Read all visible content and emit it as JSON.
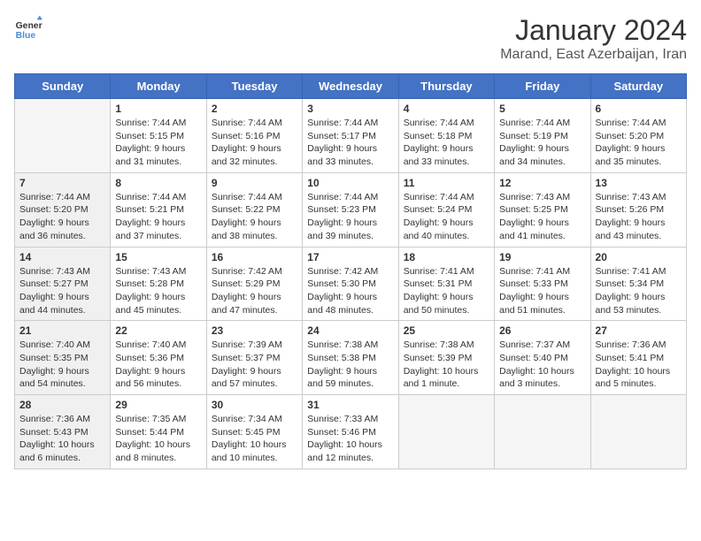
{
  "header": {
    "logo_line1": "General",
    "logo_line2": "Blue",
    "month_title": "January 2024",
    "subtitle": "Marand, East Azerbaijan, Iran"
  },
  "weekdays": [
    "Sunday",
    "Monday",
    "Tuesday",
    "Wednesday",
    "Thursday",
    "Friday",
    "Saturday"
  ],
  "weeks": [
    [
      {
        "day": "",
        "info": "",
        "shaded": true
      },
      {
        "day": "1",
        "info": "Sunrise: 7:44 AM\nSunset: 5:15 PM\nDaylight: 9 hours\nand 31 minutes.",
        "shaded": false
      },
      {
        "day": "2",
        "info": "Sunrise: 7:44 AM\nSunset: 5:16 PM\nDaylight: 9 hours\nand 32 minutes.",
        "shaded": false
      },
      {
        "day": "3",
        "info": "Sunrise: 7:44 AM\nSunset: 5:17 PM\nDaylight: 9 hours\nand 33 minutes.",
        "shaded": false
      },
      {
        "day": "4",
        "info": "Sunrise: 7:44 AM\nSunset: 5:18 PM\nDaylight: 9 hours\nand 33 minutes.",
        "shaded": false
      },
      {
        "day": "5",
        "info": "Sunrise: 7:44 AM\nSunset: 5:19 PM\nDaylight: 9 hours\nand 34 minutes.",
        "shaded": false
      },
      {
        "day": "6",
        "info": "Sunrise: 7:44 AM\nSunset: 5:20 PM\nDaylight: 9 hours\nand 35 minutes.",
        "shaded": false
      }
    ],
    [
      {
        "day": "7",
        "info": "Sunrise: 7:44 AM\nSunset: 5:20 PM\nDaylight: 9 hours\nand 36 minutes.",
        "shaded": true
      },
      {
        "day": "8",
        "info": "Sunrise: 7:44 AM\nSunset: 5:21 PM\nDaylight: 9 hours\nand 37 minutes.",
        "shaded": false
      },
      {
        "day": "9",
        "info": "Sunrise: 7:44 AM\nSunset: 5:22 PM\nDaylight: 9 hours\nand 38 minutes.",
        "shaded": false
      },
      {
        "day": "10",
        "info": "Sunrise: 7:44 AM\nSunset: 5:23 PM\nDaylight: 9 hours\nand 39 minutes.",
        "shaded": false
      },
      {
        "day": "11",
        "info": "Sunrise: 7:44 AM\nSunset: 5:24 PM\nDaylight: 9 hours\nand 40 minutes.",
        "shaded": false
      },
      {
        "day": "12",
        "info": "Sunrise: 7:43 AM\nSunset: 5:25 PM\nDaylight: 9 hours\nand 41 minutes.",
        "shaded": false
      },
      {
        "day": "13",
        "info": "Sunrise: 7:43 AM\nSunset: 5:26 PM\nDaylight: 9 hours\nand 43 minutes.",
        "shaded": false
      }
    ],
    [
      {
        "day": "14",
        "info": "Sunrise: 7:43 AM\nSunset: 5:27 PM\nDaylight: 9 hours\nand 44 minutes.",
        "shaded": true
      },
      {
        "day": "15",
        "info": "Sunrise: 7:43 AM\nSunset: 5:28 PM\nDaylight: 9 hours\nand 45 minutes.",
        "shaded": false
      },
      {
        "day": "16",
        "info": "Sunrise: 7:42 AM\nSunset: 5:29 PM\nDaylight: 9 hours\nand 47 minutes.",
        "shaded": false
      },
      {
        "day": "17",
        "info": "Sunrise: 7:42 AM\nSunset: 5:30 PM\nDaylight: 9 hours\nand 48 minutes.",
        "shaded": false
      },
      {
        "day": "18",
        "info": "Sunrise: 7:41 AM\nSunset: 5:31 PM\nDaylight: 9 hours\nand 50 minutes.",
        "shaded": false
      },
      {
        "day": "19",
        "info": "Sunrise: 7:41 AM\nSunset: 5:33 PM\nDaylight: 9 hours\nand 51 minutes.",
        "shaded": false
      },
      {
        "day": "20",
        "info": "Sunrise: 7:41 AM\nSunset: 5:34 PM\nDaylight: 9 hours\nand 53 minutes.",
        "shaded": false
      }
    ],
    [
      {
        "day": "21",
        "info": "Sunrise: 7:40 AM\nSunset: 5:35 PM\nDaylight: 9 hours\nand 54 minutes.",
        "shaded": true
      },
      {
        "day": "22",
        "info": "Sunrise: 7:40 AM\nSunset: 5:36 PM\nDaylight: 9 hours\nand 56 minutes.",
        "shaded": false
      },
      {
        "day": "23",
        "info": "Sunrise: 7:39 AM\nSunset: 5:37 PM\nDaylight: 9 hours\nand 57 minutes.",
        "shaded": false
      },
      {
        "day": "24",
        "info": "Sunrise: 7:38 AM\nSunset: 5:38 PM\nDaylight: 9 hours\nand 59 minutes.",
        "shaded": false
      },
      {
        "day": "25",
        "info": "Sunrise: 7:38 AM\nSunset: 5:39 PM\nDaylight: 10 hours\nand 1 minute.",
        "shaded": false
      },
      {
        "day": "26",
        "info": "Sunrise: 7:37 AM\nSunset: 5:40 PM\nDaylight: 10 hours\nand 3 minutes.",
        "shaded": false
      },
      {
        "day": "27",
        "info": "Sunrise: 7:36 AM\nSunset: 5:41 PM\nDaylight: 10 hours\nand 5 minutes.",
        "shaded": false
      }
    ],
    [
      {
        "day": "28",
        "info": "Sunrise: 7:36 AM\nSunset: 5:43 PM\nDaylight: 10 hours\nand 6 minutes.",
        "shaded": true
      },
      {
        "day": "29",
        "info": "Sunrise: 7:35 AM\nSunset: 5:44 PM\nDaylight: 10 hours\nand 8 minutes.",
        "shaded": false
      },
      {
        "day": "30",
        "info": "Sunrise: 7:34 AM\nSunset: 5:45 PM\nDaylight: 10 hours\nand 10 minutes.",
        "shaded": false
      },
      {
        "day": "31",
        "info": "Sunrise: 7:33 AM\nSunset: 5:46 PM\nDaylight: 10 hours\nand 12 minutes.",
        "shaded": false
      },
      {
        "day": "",
        "info": "",
        "shaded": true
      },
      {
        "day": "",
        "info": "",
        "shaded": true
      },
      {
        "day": "",
        "info": "",
        "shaded": true
      }
    ]
  ]
}
